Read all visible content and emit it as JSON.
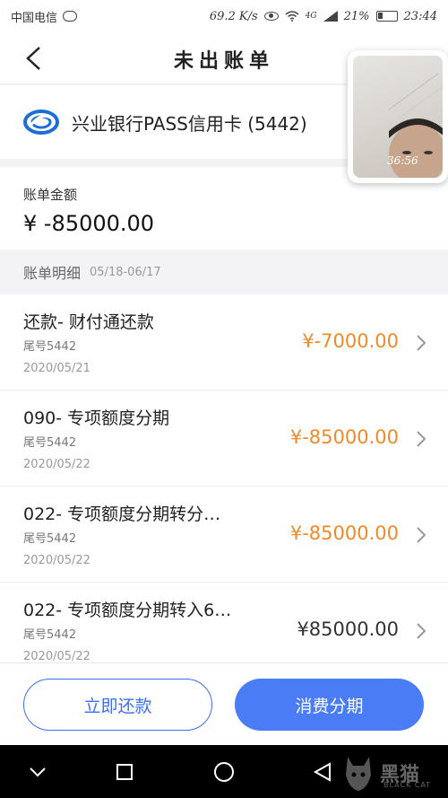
{
  "status_bar": {
    "carrier": "中国电信",
    "speed": "69.2 K/s",
    "network": "4G",
    "battery": "21%",
    "time": "23:44"
  },
  "nav": {
    "title": "未出账单"
  },
  "card": {
    "name": "兴业银行PASS信用卡 (5442)"
  },
  "amount": {
    "label": "账单金额",
    "value": "¥ -85000.00"
  },
  "detail": {
    "label": "账单明细",
    "range": "05/18-06/17"
  },
  "transactions": [
    {
      "title": "还款- 财付通还款",
      "card": "尾号5442",
      "date": "2020/05/21",
      "amount": "¥-7000.00"
    },
    {
      "title": "090- 专项额度分期",
      "card": "尾号5442",
      "date": "2020/05/22",
      "amount": "¥-85000.00"
    },
    {
      "title": "022- 专项额度分期转分…",
      "card": "尾号5442",
      "date": "2020/05/22",
      "amount": "¥-85000.00"
    },
    {
      "title": "022- 专项额度分期转入6…",
      "card": "尾号5442",
      "date": "2020/05/22",
      "amount": "¥85000.00"
    }
  ],
  "buttons": {
    "repay": "立即还款",
    "installment": "消费分期"
  },
  "pip": {
    "timer": "36:56"
  },
  "watermark": {
    "text": "黑猫",
    "sub": "BLACK CAT"
  },
  "colors": {
    "accent": "#4a7cf5",
    "negative_amount": "#ef8a2a"
  }
}
